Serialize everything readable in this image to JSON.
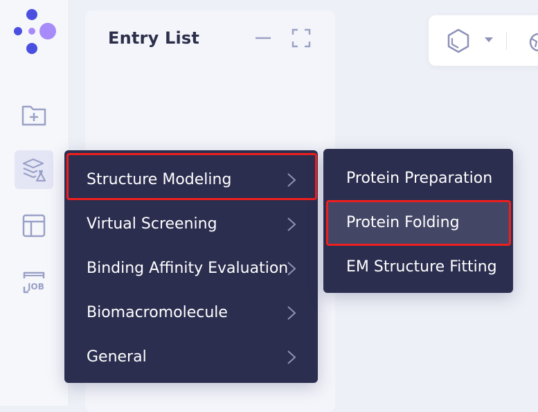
{
  "sidebar": {
    "logo_icon": "dots-logo-icon",
    "items": [
      {
        "icon": "folder-plus-icon"
      },
      {
        "icon": "flask-layers-icon",
        "active": true
      },
      {
        "icon": "layout-table-icon"
      },
      {
        "icon": "job-icon",
        "label": "JOB"
      }
    ]
  },
  "entry_panel": {
    "title": "Entry List",
    "minimize_icon": "minimize-icon",
    "maximize_icon": "maximize-icon"
  },
  "toolbar": {
    "icons": [
      "molecule-hexagon-icon",
      "caret-down-icon",
      "divider",
      "globe-icon"
    ]
  },
  "main_menu": {
    "items": [
      {
        "label": "Structure Modeling",
        "has_submenu": true,
        "highlighted": true
      },
      {
        "label": "Virtual Screening",
        "has_submenu": true
      },
      {
        "label": "Binding Affinity Evaluation",
        "has_submenu": true
      },
      {
        "label": "Biomacromolecule",
        "has_submenu": true
      },
      {
        "label": "General",
        "has_submenu": true
      }
    ]
  },
  "sub_menu": {
    "items": [
      {
        "label": "Protein Preparation"
      },
      {
        "label": "Protein Folding",
        "hovered": true,
        "highlighted": true
      },
      {
        "label": "EM Structure Fitting"
      }
    ]
  },
  "colors": {
    "menu_bg": "#2b2e4f",
    "menu_hover": "#434665",
    "highlight_border": "#f01f1f",
    "logo_blue": "#4a4fe0",
    "logo_purple": "#a78bfa",
    "icon_gray": "#9aa0c6"
  }
}
